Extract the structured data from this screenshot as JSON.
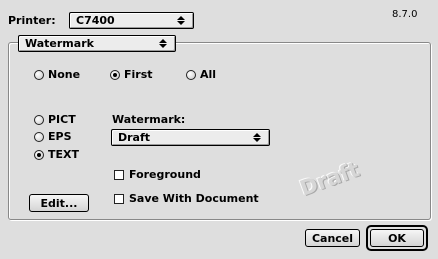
{
  "header": {
    "printer_label": "Printer:",
    "printer_value": "C7400",
    "version": "8.7.0"
  },
  "panel_popup": {
    "value": "Watermark"
  },
  "pages": {
    "options": [
      {
        "label": "None",
        "selected": false
      },
      {
        "label": "First",
        "selected": true
      },
      {
        "label": "All",
        "selected": false
      }
    ]
  },
  "format": {
    "options": [
      {
        "label": "PICT",
        "selected": false
      },
      {
        "label": "EPS",
        "selected": false
      },
      {
        "label": "TEXT",
        "selected": true
      }
    ]
  },
  "watermark": {
    "label": "Watermark:",
    "value": "Draft",
    "preview_text": "Draft"
  },
  "checkboxes": {
    "foreground": {
      "label": "Foreground",
      "checked": false
    },
    "save_with_document": {
      "label": "Save With Document",
      "checked": false
    }
  },
  "buttons": {
    "edit": "Edit...",
    "cancel": "Cancel",
    "ok": "OK"
  }
}
